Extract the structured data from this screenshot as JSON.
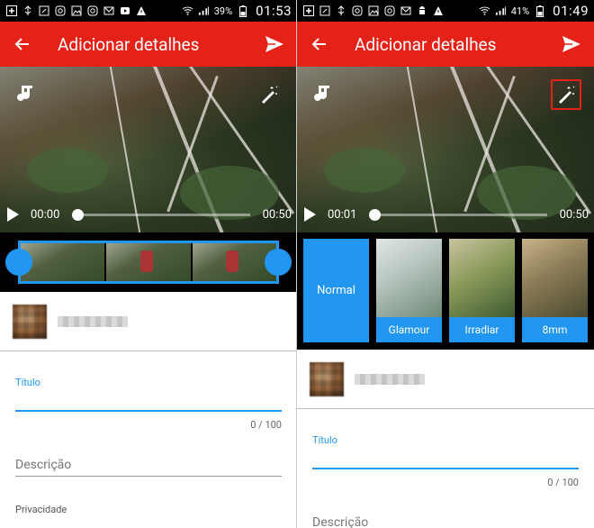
{
  "statusbar_left": {
    "battery": "39%",
    "time": "01:53"
  },
  "statusbar_right": {
    "battery": "41%",
    "time": "01:49"
  },
  "appbar": {
    "title": "Adicionar detalhes"
  },
  "player_left": {
    "current_time": "00:00",
    "duration": "00:50",
    "progress": 0.0
  },
  "player_right": {
    "current_time": "00:01",
    "duration": "00:50",
    "progress": 0.0
  },
  "filters": [
    {
      "label": "Normal",
      "selected": true
    },
    {
      "label": "Glamour"
    },
    {
      "label": "Irradiar"
    },
    {
      "label": "8mm"
    }
  ],
  "form": {
    "title_label": "Título",
    "title_counter": "0 / 100",
    "description_placeholder": "Descrição",
    "privacy_label": "Privacidade"
  },
  "colors": {
    "appbar": "#e62117",
    "accent": "#2196f3"
  },
  "icons": {
    "back": "arrow-left",
    "send": "send",
    "music": "music-note",
    "magic": "magic-wand",
    "play": "play"
  }
}
